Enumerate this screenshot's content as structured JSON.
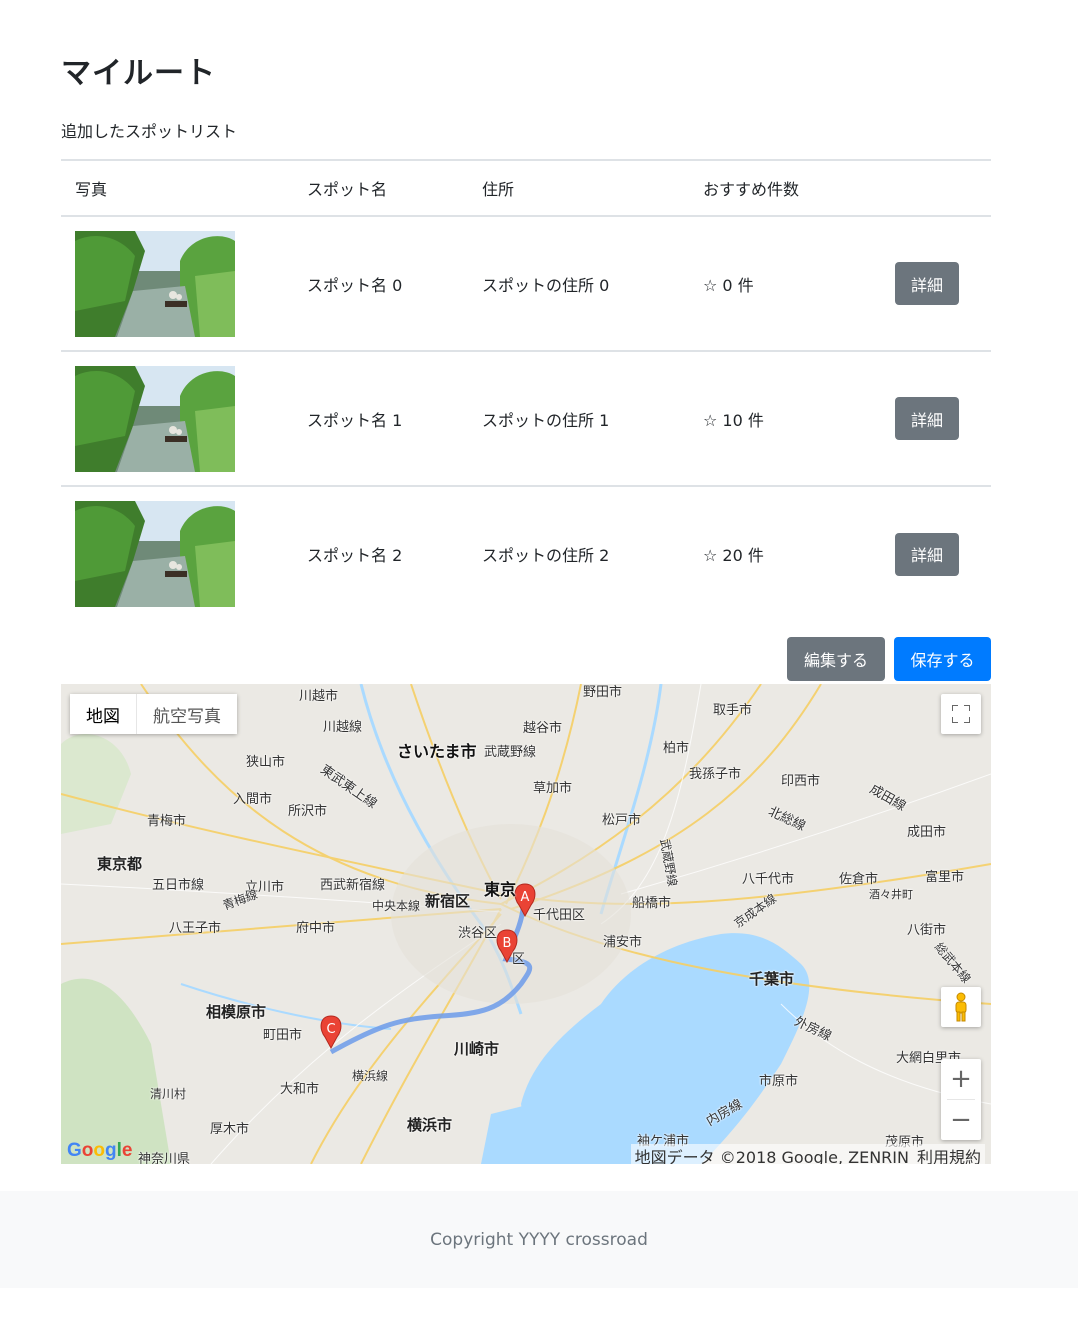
{
  "page": {
    "title": "マイルート",
    "subtitle": "追加したスポットリスト"
  },
  "table": {
    "headers": [
      "写真",
      "スポット名",
      "住所",
      "おすすめ件数"
    ],
    "rows": [
      {
        "name": "スポット名 0",
        "address": "スポットの住所 0",
        "recommend": "☆ 0 件",
        "action": "詳細"
      },
      {
        "name": "スポット名 1",
        "address": "スポットの住所 1",
        "recommend": "☆ 10 件",
        "action": "詳細"
      },
      {
        "name": "スポット名 2",
        "address": "スポットの住所 2",
        "recommend": "☆ 20 件",
        "action": "詳細"
      }
    ]
  },
  "actions": {
    "edit_label": "編集する",
    "save_label": "保存する"
  },
  "map": {
    "type_buttons": [
      "地図",
      "航空写真"
    ],
    "active_type": "地図",
    "markers": [
      "A",
      "B",
      "C"
    ],
    "attribution": "地図データ ©2018 Google, ZENRIN",
    "terms": "利用規約",
    "logo": "Google",
    "place_labels": [
      "川越市",
      "野田市",
      "取手市",
      "川越線",
      "越谷市",
      "さいたま市",
      "武蔵野線",
      "柏市",
      "狭山市",
      "我孫子市",
      "印西市",
      "東武東上線",
      "草加市",
      "入間市",
      "所沢市",
      "成田線",
      "青梅市",
      "松戸市",
      "北総線",
      "成田市",
      "東京都",
      "東京",
      "五日市線",
      "立川市",
      "西武新宿線",
      "新宿区",
      "船橋市",
      "八千代市",
      "佐倉市",
      "富里市",
      "中央本線",
      "千代田区",
      "八王子市",
      "府中市",
      "渋谷区",
      "浦安市",
      "八街市",
      "京成本線",
      "千葉市",
      "相模原市",
      "町田市",
      "川崎市",
      "外房線",
      "横浜線",
      "大和市",
      "市原市",
      "大網白里市",
      "清川村",
      "厚木市",
      "横浜市",
      "内房線",
      "袖ケ浦市",
      "茂原市",
      "神奈川県",
      "酒々井町",
      "青梅線",
      "武蔵野線",
      "総武本線",
      "区"
    ]
  },
  "colors": {
    "primary": "#007bff",
    "secondary": "#6c757d",
    "route": "#6c9bea",
    "marker": "#ea4335",
    "water": "#aadaff"
  },
  "footer": {
    "copyright": "Copyright YYYY crossroad"
  }
}
